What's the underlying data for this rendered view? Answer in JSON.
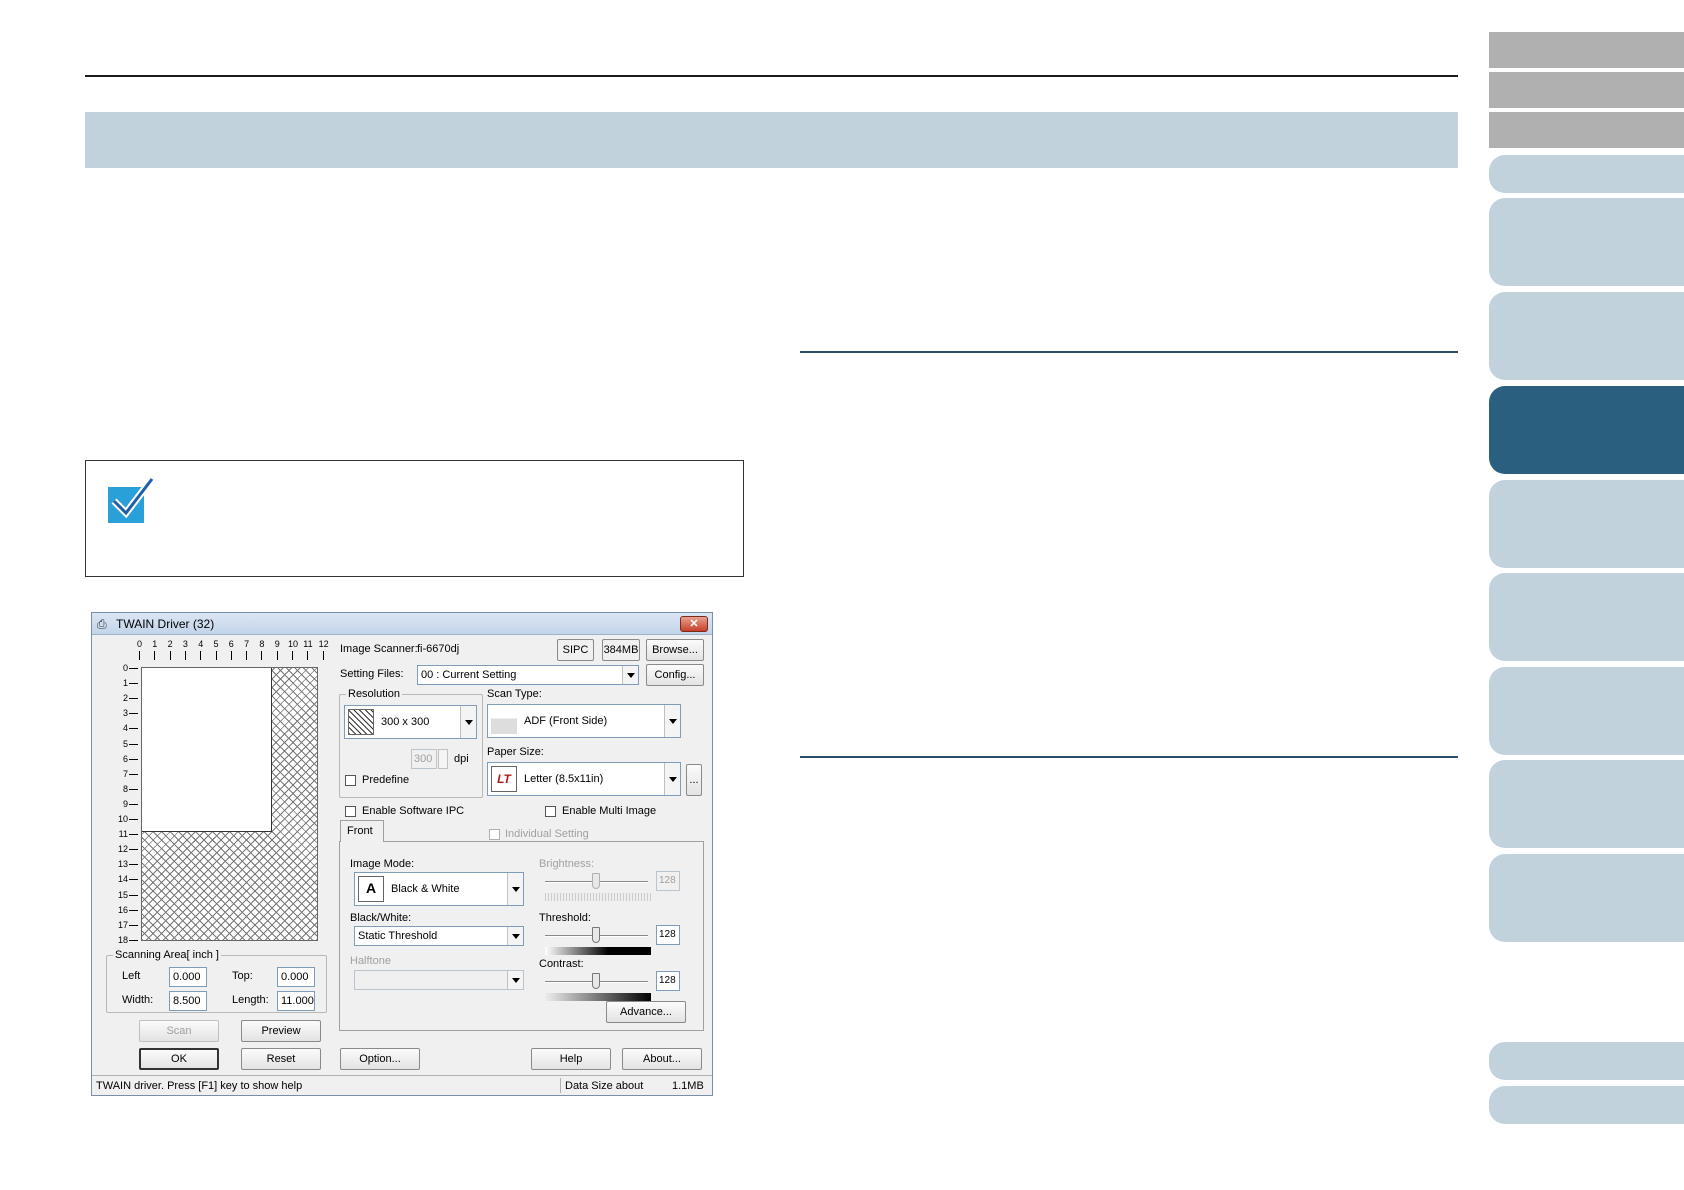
{
  "dialog": {
    "title": "TWAIN Driver (32)",
    "image_scanner_label": "Image Scanner:",
    "image_scanner_value": "fi-6670dj",
    "sipc_badge": "SIPC",
    "memory_badge": "384MB",
    "browse_button": "Browse...",
    "setting_files_label": "Setting Files:",
    "setting_files_value": "00 : Current Setting",
    "config_button": "Config...",
    "resolution_group": "Resolution",
    "resolution_value": "300 x 300",
    "dpi_value": "300",
    "dpi_unit": "dpi",
    "predefine_label": "Predefine",
    "scan_type_label": "Scan Type:",
    "scan_type_value": "ADF (Front Side)",
    "paper_size_label": "Paper Size:",
    "paper_size_value": "Letter (8.5x11in)",
    "paper_more_button": "...",
    "enable_software_ipc": "Enable Software IPC",
    "enable_multi_image": "Enable Multi Image",
    "tab_front": "Front",
    "individual_setting": "Individual Setting",
    "image_mode_label": "Image Mode:",
    "image_mode_value": "Black & White",
    "bw_label": "Black/White:",
    "bw_value": "Static Threshold",
    "halftone_label": "Halftone",
    "halftone_value": "",
    "brightness_label": "Brightness:",
    "brightness_value": "128",
    "threshold_label": "Threshold:",
    "threshold_value": "128",
    "contrast_label": "Contrast:",
    "contrast_value": "128",
    "advance_button": "Advance...",
    "scanning_area_label": "Scanning Area[ inch ]",
    "left_label": "Left",
    "left_value": "0.000",
    "top_label": "Top:",
    "top_value": "0.000",
    "width_label": "Width:",
    "width_value": "8.500",
    "length_label": "Length:",
    "length_value": "11.000",
    "scan_button": "Scan",
    "preview_button": "Preview",
    "ok_button": "OK",
    "reset_button": "Reset",
    "option_button": "Option...",
    "help_button": "Help",
    "about_button": "About...",
    "status_text": "TWAIN driver. Press [F1] key to show help",
    "data_size_label": "Data Size about",
    "data_size_value": "1.1MB",
    "ruler_h": [
      "0",
      "1",
      "2",
      "3",
      "4",
      "5",
      "6",
      "7",
      "8",
      "9",
      "10",
      "11",
      "12"
    ],
    "ruler_v": [
      "0",
      "1",
      "2",
      "3",
      "4",
      "5",
      "6",
      "7",
      "8",
      "9",
      "10",
      "11",
      "12",
      "13",
      "14",
      "15",
      "16",
      "17",
      "18"
    ]
  },
  "colors": {
    "title_band": "#c2d2dc",
    "section_rule": "#2a4f6b",
    "tab_gray": "#b0b0b0",
    "tab_light": "#c2d2dc",
    "tab_active": "#2a5f80",
    "hint_icon": "#29a0d8"
  },
  "icons": {
    "hint": "checkmark-icon",
    "window": "scanner-icon",
    "close": "close-icon"
  }
}
